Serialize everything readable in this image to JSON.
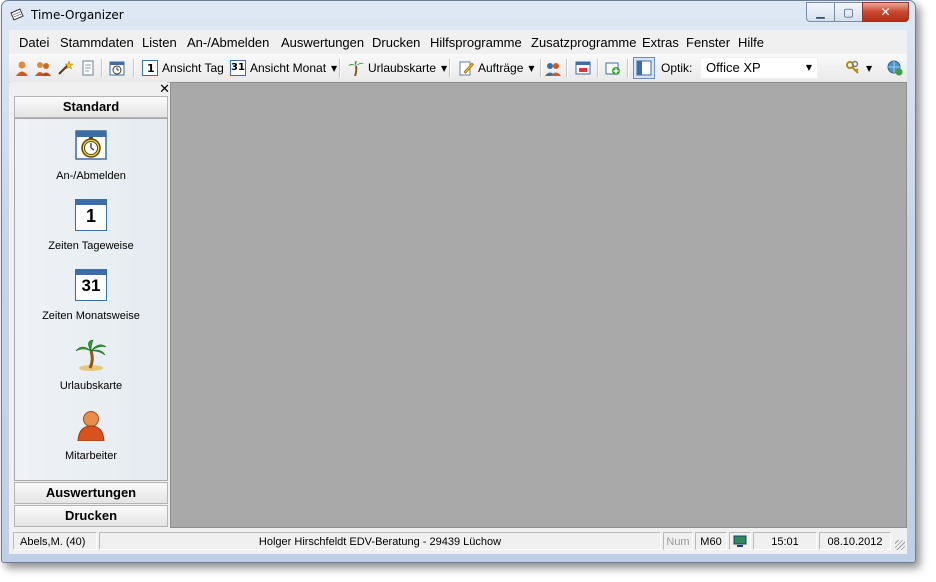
{
  "window": {
    "title": "Time-Organizer"
  },
  "menu": [
    "Datei",
    "Stammdaten",
    "Listen",
    "An-/Abmelden",
    "Auswertungen",
    "Drucken",
    "Hilfsprogramme",
    "Zusatzprogramme",
    "Extras",
    "Fenster",
    "Hilfe"
  ],
  "toolbar": {
    "ansicht_tag": "Ansicht Tag",
    "ansicht_monat": "Ansicht Monat",
    "urlaubskarte": "Urlaubskarte",
    "auftraege": "Aufträge",
    "optik_label": "Optik:",
    "optik_value": "Office XP",
    "calendar_day": "1",
    "calendar_month": "31"
  },
  "sidebar": {
    "header": "Standard",
    "items": [
      {
        "label": "An-/Abmelden",
        "icon": "stopwatch-calendar-icon"
      },
      {
        "label": "Zeiten Tageweise",
        "icon": "calendar-day-icon",
        "num": "1"
      },
      {
        "label": "Zeiten Monatsweise",
        "icon": "calendar-month-icon",
        "num": "31"
      },
      {
        "label": "Urlaubskarte",
        "icon": "palm-tree-icon"
      },
      {
        "label": "Mitarbeiter",
        "icon": "person-icon"
      }
    ],
    "bottom_groups": [
      "Auswertungen",
      "Drucken"
    ]
  },
  "statusbar": {
    "user": "Abels,M. (40)",
    "company": "Holger Hirschfeldt EDV-Beratung - 29439 Lüchow",
    "num": "Num",
    "m60": "M60",
    "time": "15:01",
    "date": "08.10.2012"
  },
  "colors": {
    "mdi_background": "#a9a9a9",
    "accent": "#3a6ea5"
  }
}
